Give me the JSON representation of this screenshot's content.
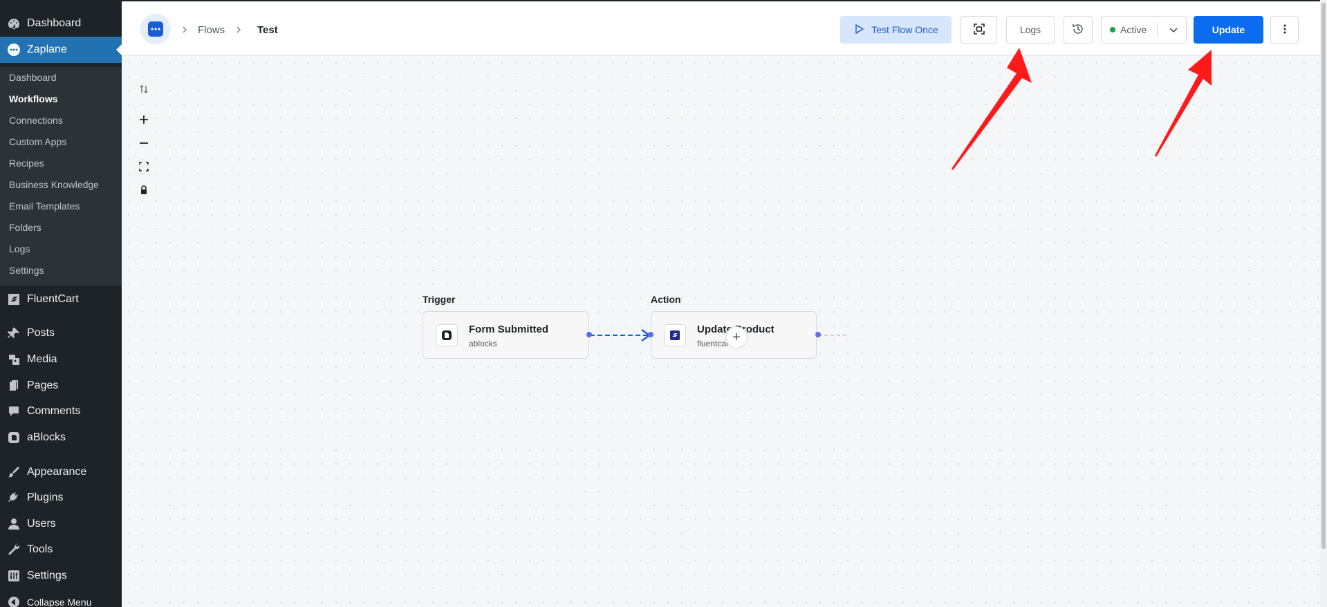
{
  "sidebar": {
    "top_items": [
      {
        "label": "Dashboard",
        "icon": "dashboard-icon"
      },
      {
        "label": "Zaplane",
        "icon": "zaplane-icon"
      }
    ],
    "submenu": [
      {
        "label": "Dashboard"
      },
      {
        "label": "Workflows"
      },
      {
        "label": "Connections"
      },
      {
        "label": "Custom Apps"
      },
      {
        "label": "Recipes"
      },
      {
        "label": "Business Knowledge"
      },
      {
        "label": "Email Templates"
      },
      {
        "label": "Folders"
      },
      {
        "label": "Logs"
      },
      {
        "label": "Settings"
      }
    ],
    "items": [
      {
        "label": "FluentCart",
        "icon": "fluentcart-icon"
      },
      {
        "label": "Posts",
        "icon": "pin-icon"
      },
      {
        "label": "Media",
        "icon": "media-icon"
      },
      {
        "label": "Pages",
        "icon": "pages-icon"
      },
      {
        "label": "Comments",
        "icon": "comment-icon"
      },
      {
        "label": "aBlocks",
        "icon": "ablocks-icon"
      },
      {
        "label": "Appearance",
        "icon": "brush-icon"
      },
      {
        "label": "Plugins",
        "icon": "plug-icon"
      },
      {
        "label": "Users",
        "icon": "user-icon"
      },
      {
        "label": "Tools",
        "icon": "wrench-icon"
      },
      {
        "label": "Settings",
        "icon": "settings-sliders-icon"
      },
      {
        "label": "Collapse Menu",
        "icon": "collapse-icon"
      }
    ]
  },
  "header": {
    "breadcrumb": [
      "Flows",
      "Test"
    ],
    "test_flow_label": "Test Flow Once",
    "logs_label": "Logs",
    "status_label": "Active",
    "update_label": "Update"
  },
  "flow": {
    "trigger": {
      "section_label": "Trigger",
      "title": "Form Submitted",
      "app": "ablocks"
    },
    "action": {
      "section_label": "Action",
      "title": "Update Product",
      "app": "fluentcart"
    }
  },
  "colors": {
    "wp_sidebar": "#1d2327",
    "wp_accent": "#2271b1",
    "primary": "#0b6cf0",
    "status_active": "#16a34a",
    "annotation_arrow": "#ff1a1a"
  }
}
